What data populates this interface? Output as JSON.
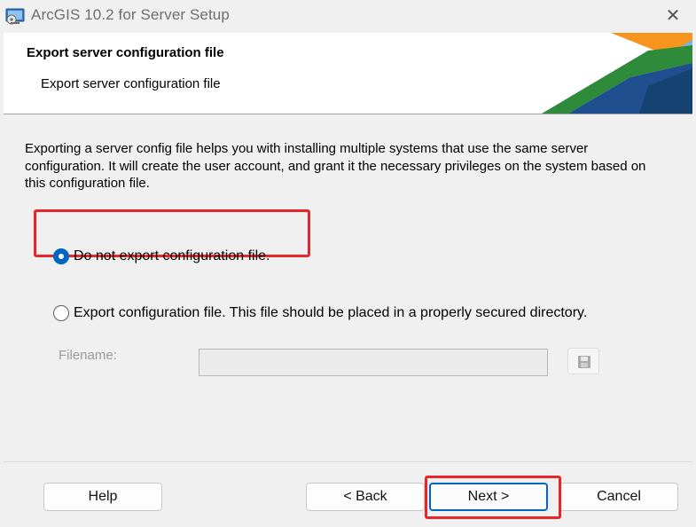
{
  "window": {
    "title": "ArcGIS 10.2 for Server Setup",
    "close_glyph": "✕"
  },
  "banner": {
    "title": "Export server configuration file",
    "subtitle": "Export server configuration file"
  },
  "description": "Exporting a server config file helps you with installing multiple systems that use the same server configuration.  It will create the user account, and grant it the necessary privileges on the system based on this configuration file.",
  "options": [
    {
      "label": "Do not export configuration file.",
      "selected": true
    },
    {
      "label": "Export configuration file. This file should be placed in a properly secured directory.",
      "selected": false
    }
  ],
  "filename": {
    "label": "Filename:",
    "value": ""
  },
  "buttons": {
    "help": "Help",
    "back": "< Back",
    "next": "Next >",
    "cancel": "Cancel"
  },
  "colors": {
    "accent": "#0067c0",
    "highlight": "#e8262a",
    "banner_orange": "#f7941d",
    "banner_blue": "#1f6db5",
    "banner_green": "#3a9a3a"
  },
  "icons": [
    "app-icon",
    "close-icon",
    "save-icon",
    "radio-selected-icon",
    "radio-unselected-icon"
  ]
}
